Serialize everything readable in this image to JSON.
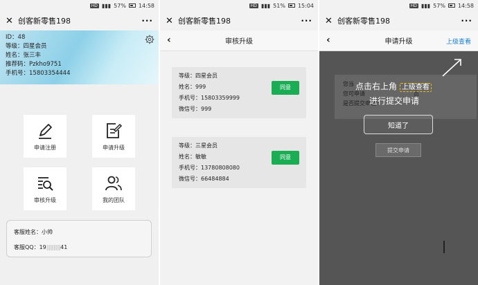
{
  "status": {
    "p1": {
      "hd": "HD",
      "battery": "57%",
      "time": "14:58"
    },
    "p2": {
      "hd": "HD",
      "battery": "51%",
      "time": "15:04"
    },
    "p3": {
      "hd": "HD",
      "battery": "57%",
      "time": "14:58"
    }
  },
  "app": {
    "title": "创客新零售198",
    "close": "✕",
    "more": "···"
  },
  "profile": {
    "id": "ID：48",
    "level": "等级：四星会员",
    "name": "姓名：张三丰",
    "referral": "推荐码：Pzkho9751",
    "phone": "手机号：15803354444"
  },
  "menu": [
    {
      "label": "申请注册",
      "icon": "pen-icon"
    },
    {
      "label": "申请升级",
      "icon": "edit-document-icon"
    },
    {
      "label": "审核升级",
      "icon": "list-search-icon"
    },
    {
      "label": "我的团队",
      "icon": "team-icon"
    }
  ],
  "service": {
    "name_label": "客服姓名：小帅",
    "qq_label": "客服QQ：19",
    "qq_hidden": "||||||||||||",
    "qq_tail": "41"
  },
  "review": {
    "title": "审核升级",
    "cards": [
      {
        "level": "等级：四星会员",
        "name": "姓名：999",
        "phone": "手机号：15803359999",
        "wechat": "微信号：999",
        "action": "同意"
      },
      {
        "level": "等级：三星会员",
        "name": "姓名：敏敏",
        "phone": "手机号：13780808080",
        "wechat": "微信号：66484884",
        "action": "同意"
      }
    ]
  },
  "apply": {
    "title": "申请升级",
    "top_link": "上级查看",
    "ghost_line1": "您当",
    "ghost_line2": "您可申请",
    "ghost_line2_tail": "员",
    "ghost_line3": "是否提交申请？",
    "hint_prefix": "点击右上角",
    "hint_highlight": "上级查看",
    "hint_line2": "进行提交申请",
    "got_it": "知道了",
    "submit": "提交申请"
  },
  "colors": {
    "accent_green": "#1aad53",
    "link_blue": "#1a7fd4",
    "overlay": "#555555",
    "highlight": "#f2c200"
  }
}
